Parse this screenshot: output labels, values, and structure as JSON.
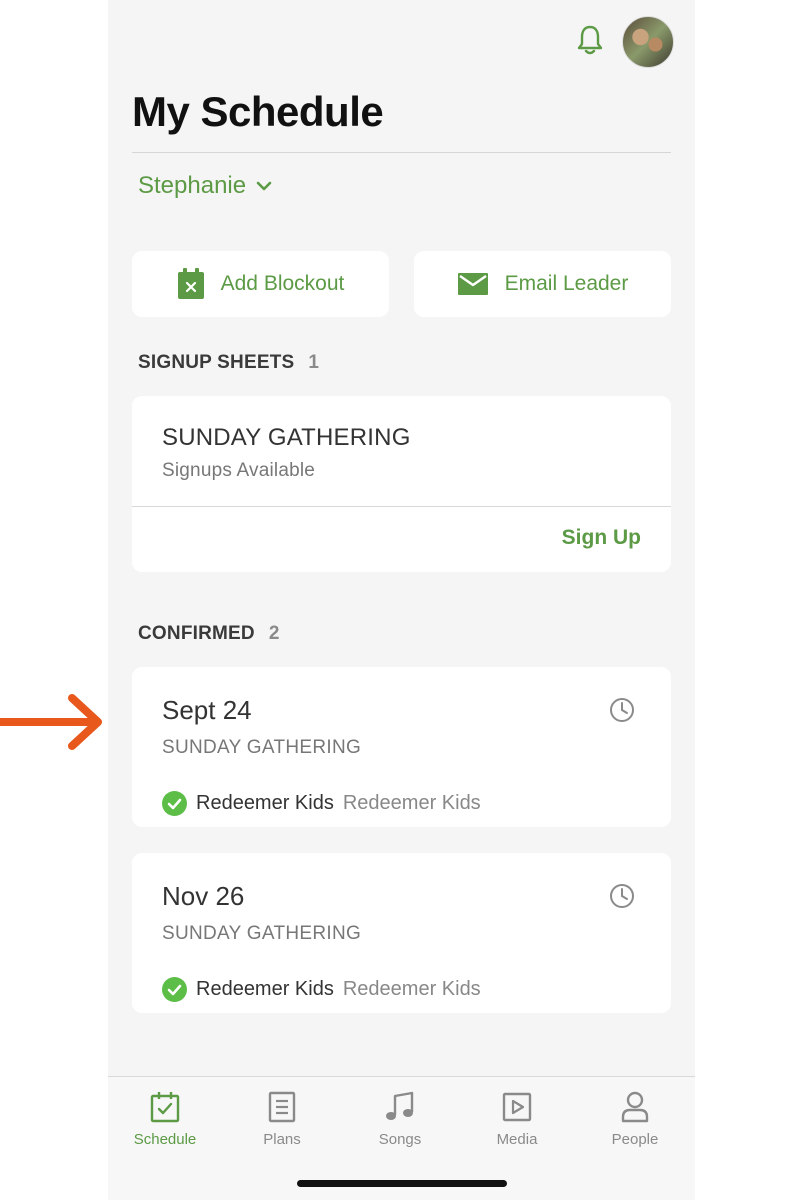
{
  "colors": {
    "accent": "#5c9a45",
    "arrow": "#e8581c",
    "background": "#f5f5f5"
  },
  "header": {
    "title": "My Schedule",
    "bell_icon": "bell-icon",
    "avatar": "user-avatar"
  },
  "person_selector": {
    "name": "Stephanie"
  },
  "actions": {
    "add_blockout": "Add Blockout",
    "email_leader": "Email Leader"
  },
  "signup_sheets": {
    "heading": "SIGNUP SHEETS",
    "count": "1",
    "items": [
      {
        "title": "SUNDAY GATHERING",
        "subtitle": "Signups Available",
        "action": "Sign Up"
      }
    ]
  },
  "confirmed": {
    "heading": "CONFIRMED",
    "count": "2",
    "items": [
      {
        "date": "Sept 24",
        "service": "SUNDAY GATHERING",
        "team": "Redeemer Kids",
        "position": "Redeemer Kids"
      },
      {
        "date": "Nov 26",
        "service": "SUNDAY GATHERING",
        "team": "Redeemer Kids",
        "position": "Redeemer Kids"
      }
    ]
  },
  "tabs": [
    {
      "label": "Schedule",
      "icon": "calendar-check-icon"
    },
    {
      "label": "Plans",
      "icon": "document-icon"
    },
    {
      "label": "Songs",
      "icon": "music-note-icon"
    },
    {
      "label": "Media",
      "icon": "play-icon"
    },
    {
      "label": "People",
      "icon": "person-icon"
    }
  ]
}
